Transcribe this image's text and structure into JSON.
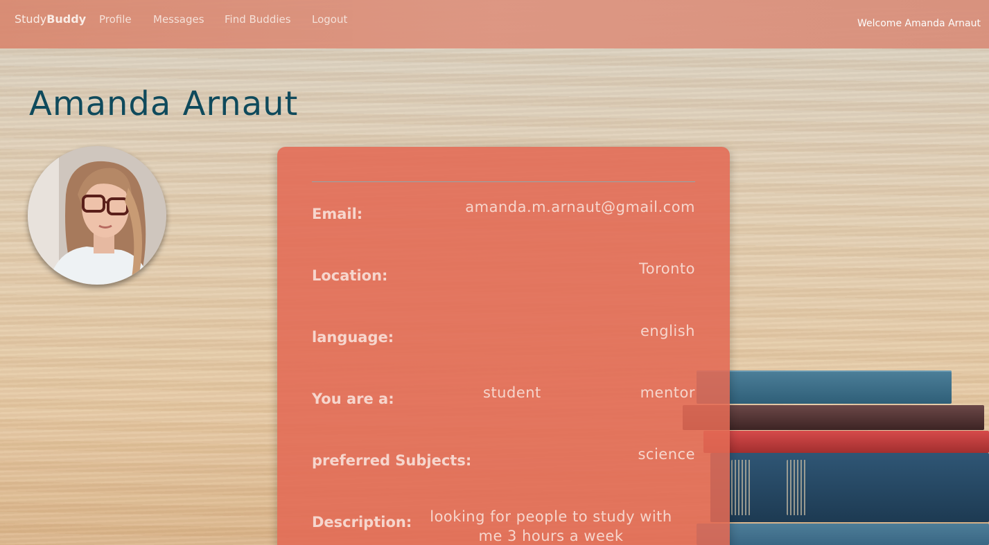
{
  "navbar": {
    "brand_light": "Study",
    "brand_bold": "Buddy",
    "links": [
      "Profile",
      "Messages",
      "Find Buddies",
      "Logout"
    ],
    "welcome": "Welcome Amanda Arnaut"
  },
  "profile": {
    "name": "Amanda Arnaut",
    "email_label": "Email:",
    "email": "amanda.m.arnaut@gmail.com",
    "location_label": "Location:",
    "location": "Toronto",
    "language_label": "language:",
    "language": "english",
    "role_label": "You are a:",
    "role_option_1": "student",
    "role_option_2": "mentor",
    "subjects_label": "preferred Subjects:",
    "subjects": "science",
    "description_label": "Description:",
    "description": "looking for people to study with me 3 hours a week"
  },
  "colors": {
    "navbar": "#dd9581",
    "title": "#0f4a5c",
    "card": "#e26a54",
    "card_text": "#f6d6cd"
  }
}
